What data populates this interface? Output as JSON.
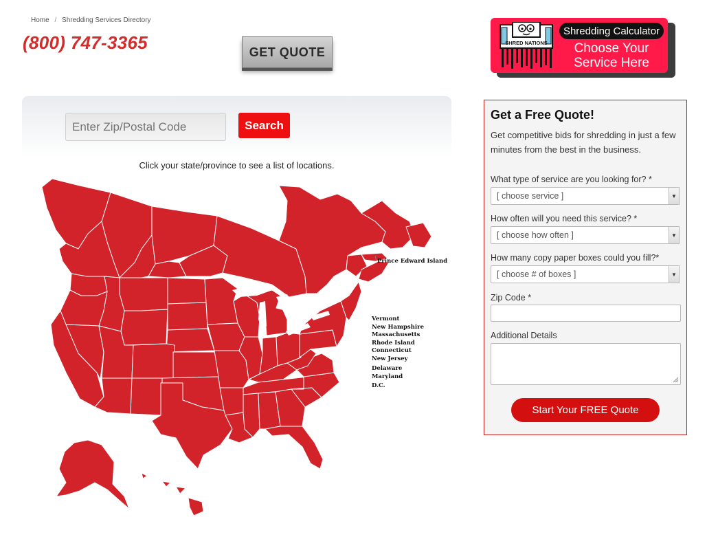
{
  "breadcrumb": {
    "home": "Home",
    "separator": "/",
    "current": "Shredding Services Directory"
  },
  "header": {
    "phone": "(800) 747-3365",
    "get_quote_label": "GET QUOTE"
  },
  "calculator_banner": {
    "pill": "Shredding Calculator",
    "line1": "Choose Your",
    "line2": "Service Here",
    "logo_text": "SHRED NATIONS"
  },
  "search": {
    "placeholder": "Enter Zip/Postal Code",
    "button_label": "Search"
  },
  "map": {
    "caption": "Click your state/province to see a list of locations.",
    "pei_label": "Prince Edward Island",
    "northeast_labels": [
      "Vermont",
      "New Hampshire",
      "Massachusetts",
      "Rhode Island",
      "Connecticut",
      "New Jersey",
      "Delaware",
      "Maryland",
      "D.C."
    ],
    "fill_color": "#d2232a"
  },
  "quote_form": {
    "title": "Get a Free Quote!",
    "subtitle": "Get competitive bids for shredding in just a few minutes from the best in the business.",
    "service_label": "What type of service are you looking for? *",
    "service_value": "[ choose service ]",
    "frequency_label": "How often will you need this service? *",
    "frequency_value": "[ choose how often ]",
    "boxes_label": "How many copy paper boxes could you fill?*",
    "boxes_value": "[ choose # of boxes ]",
    "zip_label": "Zip Code *",
    "zip_value": "",
    "details_label": "Additional Details",
    "details_value": "",
    "submit_label": "Start Your FREE Quote"
  },
  "colors": {
    "brand_red": "#d42b2b",
    "button_red": "#ee1010",
    "banner_pink": "#ff1a4a",
    "form_border": "#c21e1e"
  }
}
